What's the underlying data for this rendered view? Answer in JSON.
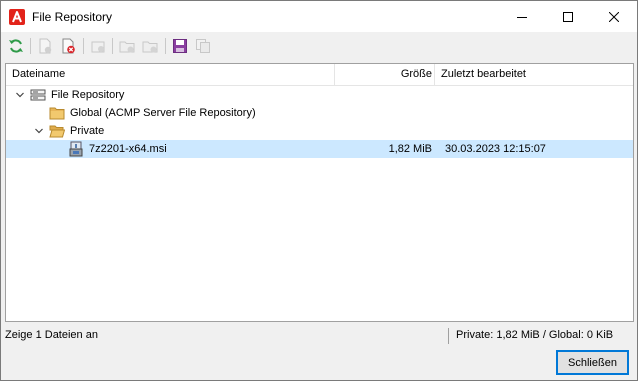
{
  "window": {
    "title": "File Repository",
    "app_icon": "acmp-logo-icon",
    "controls": [
      "minimize-icon",
      "maximize-icon",
      "close-icon"
    ]
  },
  "toolbar": {
    "buttons": [
      {
        "icon": "refresh-icon",
        "enabled": true
      },
      {
        "icon": "add-file-icon",
        "enabled": false
      },
      {
        "icon": "delete-file-icon",
        "enabled": true
      },
      {
        "icon": "file-properties-icon",
        "enabled": false
      },
      {
        "icon": "add-folder-icon",
        "enabled": false
      },
      {
        "icon": "delete-folder-icon",
        "enabled": false
      },
      {
        "icon": "save-icon",
        "enabled": true
      },
      {
        "icon": "copy-icon",
        "enabled": false
      }
    ]
  },
  "columns": {
    "name": "Dateiname",
    "size": "Größe",
    "modified": "Zuletzt bearbeitet"
  },
  "tree": {
    "root": {
      "label": "File Repository",
      "icon": "server-icon",
      "expanded": true
    },
    "global": {
      "label": "Global (ACMP Server File Repository)",
      "icon": "folder-icon"
    },
    "private": {
      "label": "Private",
      "icon": "folder-open-icon",
      "expanded": true
    },
    "file": {
      "label": "7z2201-x64.msi",
      "icon": "msi-installer-icon",
      "size": "1,82 MiB",
      "modified": "30.03.2023 12:15:07",
      "selected": true
    }
  },
  "status": {
    "left": "Zeige 1 Dateien an",
    "right": "Private: 1,82 MiB  /  Global: 0 KiB"
  },
  "buttons": {
    "close_label": "Schließen"
  },
  "colors": {
    "selection": "#cce8ff",
    "accent": "#0078d7",
    "app_red": "#e2231a",
    "folder": "#e8b65a"
  }
}
